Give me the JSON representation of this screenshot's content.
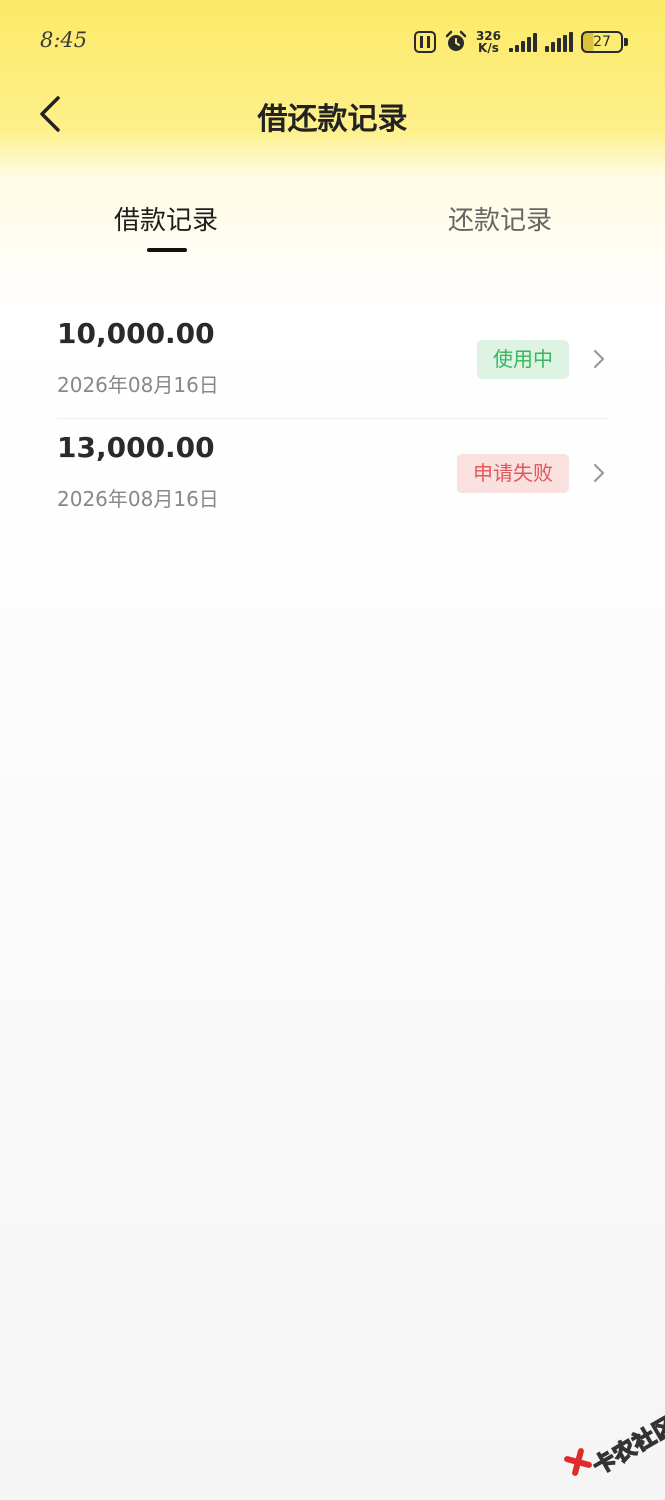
{
  "status_bar": {
    "time": "8:45",
    "speed_value": "326",
    "speed_unit": "K/s",
    "battery": "27"
  },
  "header": {
    "title": "借还款记录"
  },
  "tabs": [
    {
      "label": "借款记录",
      "active": true
    },
    {
      "label": "还款记录",
      "active": false
    }
  ],
  "records": [
    {
      "amount": "10,000.00",
      "date": "2026年08月16日",
      "status": "使用中",
      "status_color": "#35b75e"
    },
    {
      "amount": "13,000.00",
      "date": "2026年08月16日",
      "status": "申请失败",
      "status_color": "#e0585a"
    }
  ],
  "watermark": {
    "text": "卡农社区"
  },
  "colors": {
    "header_yellow": "#fbea68",
    "success_green": "#35b75e",
    "fail_red": "#e0585a"
  }
}
